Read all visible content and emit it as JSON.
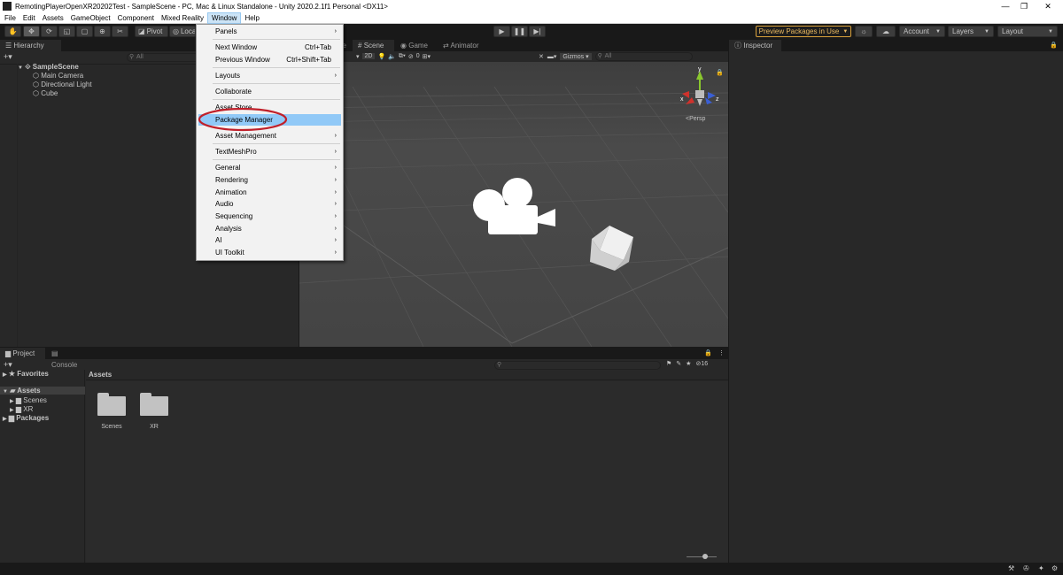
{
  "window": {
    "title": "RemotingPlayerOpenXR20202Test - SampleScene - PC, Mac & Linux Standalone - Unity 2020.2.1f1 Personal <DX11>",
    "controls": [
      "—",
      "❐",
      "✕"
    ]
  },
  "menubar": [
    "File",
    "Edit",
    "Assets",
    "GameObject",
    "Component",
    "Mixed Reality",
    "Window",
    "Help"
  ],
  "toolbar": {
    "pivot": "Pivot",
    "local": "Local",
    "preview_packages": "Preview Packages in Use",
    "account": "Account",
    "layers": "Layers",
    "layout": "Layout"
  },
  "hierarchy": {
    "tab": "Hierarchy",
    "search_placeholder": "All",
    "scene": "SampleScene",
    "objects": [
      "Main Camera",
      "Directional Light",
      "Cube"
    ]
  },
  "scene_view": {
    "tabs": [
      "Scene",
      "Game",
      "Animator"
    ],
    "tab_partial": "e",
    "mode_2d": "2D",
    "hidden_count": "0",
    "gizmos": "Gizmos",
    "search_placeholder": "All",
    "persp": "Persp",
    "axes": {
      "x": "x",
      "y": "y",
      "z": "z"
    }
  },
  "inspector": {
    "tab": "Inspector"
  },
  "project": {
    "tabs": [
      "Project",
      "Console"
    ],
    "favorites": "Favorites",
    "assets": "Assets",
    "asset_folders": [
      "Scenes",
      "XR"
    ],
    "packages": "Packages",
    "breadcrumb": "Assets",
    "hidden_count": "16",
    "grid_items": [
      "Scenes",
      "XR"
    ]
  },
  "window_menu": {
    "items": [
      {
        "label": "Panels",
        "submenu": true
      },
      {
        "label": "Next Window",
        "shortcut": "Ctrl+Tab"
      },
      {
        "label": "Previous Window",
        "shortcut": "Ctrl+Shift+Tab"
      },
      {
        "label": "Layouts",
        "submenu": true
      },
      {
        "label": "Collaborate"
      },
      {
        "label": "Asset Store"
      },
      {
        "label": "Package Manager",
        "highlighted": true
      },
      {
        "label": "Asset Management",
        "submenu": true
      },
      {
        "label": "TextMeshPro",
        "submenu": true
      },
      {
        "label": "General",
        "submenu": true
      },
      {
        "label": "Rendering",
        "submenu": true
      },
      {
        "label": "Animation",
        "submenu": true
      },
      {
        "label": "Audio",
        "submenu": true
      },
      {
        "label": "Sequencing",
        "submenu": true
      },
      {
        "label": "Analysis",
        "submenu": true
      },
      {
        "label": "AI",
        "submenu": true
      },
      {
        "label": "UI Toolkit",
        "submenu": true
      }
    ],
    "annotation_color": "#c0202a"
  },
  "colors": {
    "menu_highlight": "#91c9f7",
    "preview_border": "#d9a13b",
    "axis_x": "#d0322c",
    "axis_y": "#8ac72e",
    "axis_z": "#3a5fd6"
  }
}
